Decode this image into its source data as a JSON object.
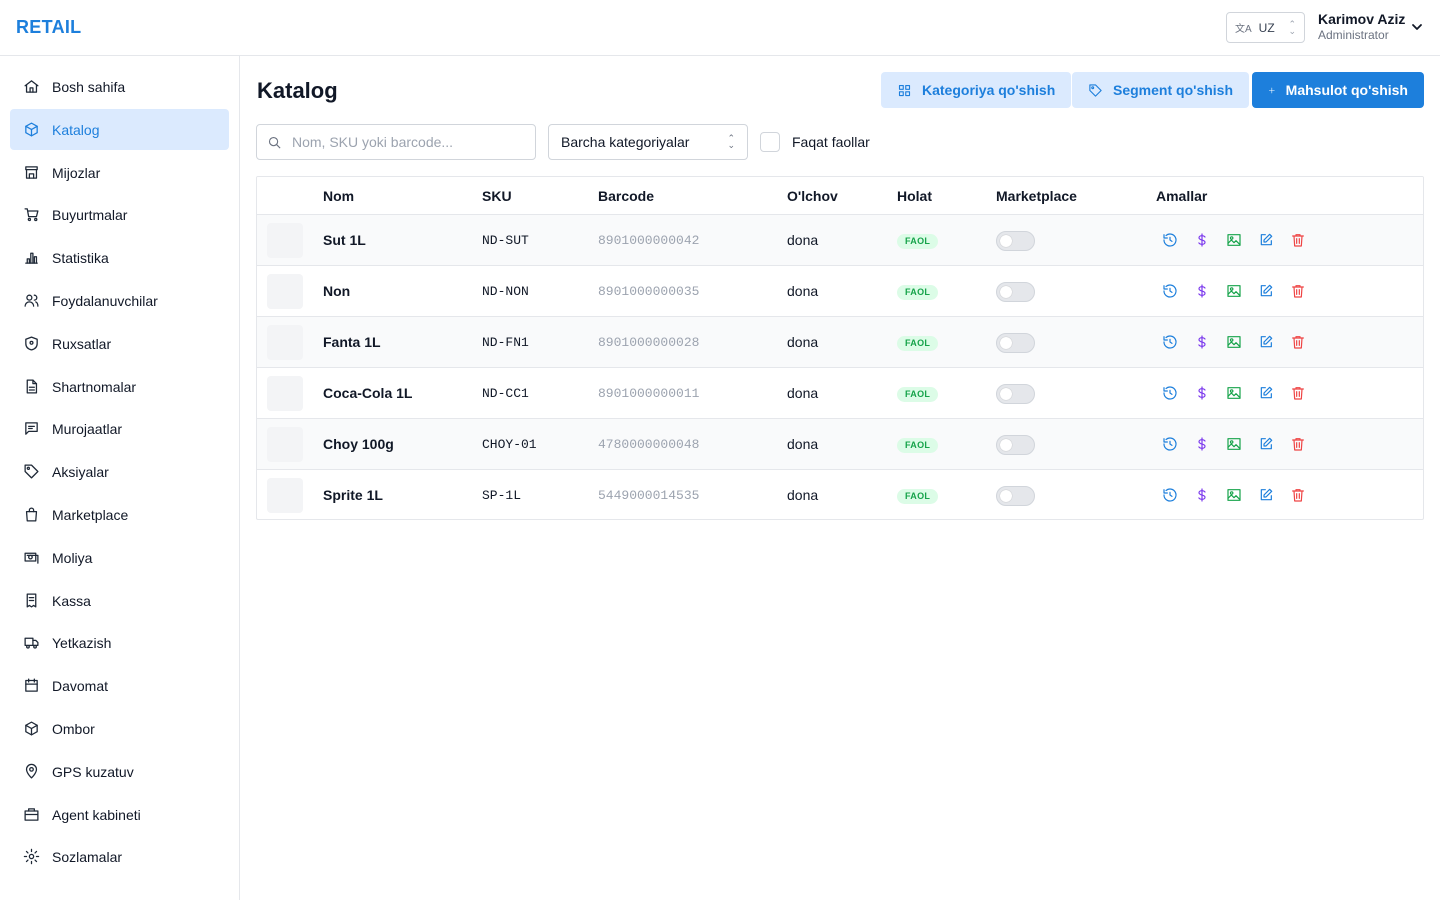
{
  "brand": "RETAIL",
  "header": {
    "language": "UZ",
    "user_name": "Karimov Aziz",
    "user_role": "Administrator"
  },
  "sidebar": {
    "items": [
      {
        "label": "Bosh sahifa",
        "icon": "home-icon"
      },
      {
        "label": "Katalog",
        "icon": "box-icon",
        "active": true
      },
      {
        "label": "Mijozlar",
        "icon": "store-icon"
      },
      {
        "label": "Buyurtmalar",
        "icon": "cart-icon"
      },
      {
        "label": "Statistika",
        "icon": "bar-chart-icon"
      },
      {
        "label": "Foydalanuvchilar",
        "icon": "users-icon"
      },
      {
        "label": "Ruxsatlar",
        "icon": "shield-icon"
      },
      {
        "label": "Shartnomalar",
        "icon": "document-icon"
      },
      {
        "label": "Murojaatlar",
        "icon": "message-icon"
      },
      {
        "label": "Aksiyalar",
        "icon": "tag-icon"
      },
      {
        "label": "Marketplace",
        "icon": "shopping-bag-icon"
      },
      {
        "label": "Moliya",
        "icon": "money-icon"
      },
      {
        "label": "Kassa",
        "icon": "receipt-icon"
      },
      {
        "label": "Yetkazish",
        "icon": "truck-icon"
      },
      {
        "label": "Davomat",
        "icon": "calendar-icon"
      },
      {
        "label": "Ombor",
        "icon": "warehouse-box-icon"
      },
      {
        "label": "GPS kuzatuv",
        "icon": "location-pin-icon"
      },
      {
        "label": "Agent kabineti",
        "icon": "briefcase-icon"
      },
      {
        "label": "Sozlamalar",
        "icon": "gear-icon"
      }
    ]
  },
  "main": {
    "title": "Katalog",
    "buttons": {
      "add_category": "Kategoriya qo'shish",
      "add_segment": "Segment qo'shish",
      "add_product": "Mahsulot qo'shish"
    },
    "search": {
      "placeholder": "Nom, SKU yoki barcode...",
      "value": ""
    },
    "category_select": "Barcha kategoriyalar",
    "active_only_label": "Faqat faollar",
    "active_only_checked": false
  },
  "table": {
    "columns": [
      "Nom",
      "SKU",
      "Barcode",
      "O'lchov",
      "Holat",
      "Marketplace",
      "Amallar"
    ],
    "rows": [
      {
        "name": "Sut 1L",
        "sku": "ND-SUT",
        "barcode": "8901000000042",
        "unit": "dona",
        "status": "FAOL",
        "marketplace": false
      },
      {
        "name": "Non",
        "sku": "ND-NON",
        "barcode": "8901000000035",
        "unit": "dona",
        "status": "FAOL",
        "marketplace": false
      },
      {
        "name": "Fanta 1L",
        "sku": "ND-FN1",
        "barcode": "8901000000028",
        "unit": "dona",
        "status": "FAOL",
        "marketplace": false
      },
      {
        "name": "Coca-Cola 1L",
        "sku": "ND-CC1",
        "barcode": "8901000000011",
        "unit": "dona",
        "status": "FAOL",
        "marketplace": false
      },
      {
        "name": "Choy 100g",
        "sku": "CHOY-01",
        "barcode": "4780000000048",
        "unit": "dona",
        "status": "FAOL",
        "marketplace": false
      },
      {
        "name": "Sprite 1L",
        "sku": "SP-1L",
        "barcode": "5449000014535",
        "unit": "dona",
        "status": "FAOL",
        "marketplace": false
      }
    ],
    "action_icons": [
      "history-icon",
      "dollar-icon",
      "image-icon",
      "edit-icon",
      "trash-icon"
    ]
  },
  "colors": {
    "accent": "#1d7fdc",
    "active_bg": "#dbeafe",
    "status_active": "#16a34a",
    "danger": "#ef4444",
    "price": "#7c3aed"
  }
}
